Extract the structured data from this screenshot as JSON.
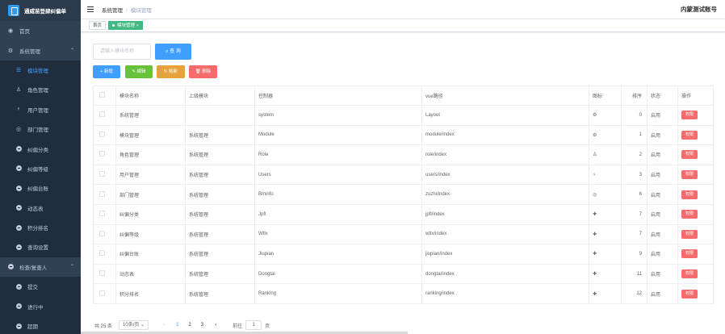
{
  "app": {
    "title": "通威苗登肆纠偏单"
  },
  "sidebar": {
    "items": [
      {
        "label": "首页",
        "icon": "dashboard-icon"
      },
      {
        "label": "系统管理",
        "icon": "gear-icon"
      },
      {
        "label": "模块管理",
        "icon": "menu-icon"
      },
      {
        "label": "角色管理",
        "icon": "user-icon"
      },
      {
        "label": "用户管理",
        "icon": "bulb-icon"
      },
      {
        "label": "部门管理",
        "icon": "target-icon"
      },
      {
        "label": "纠偏分类",
        "icon": "circle-plus-icon"
      },
      {
        "label": "纠偏等级",
        "icon": "circle-plus-icon"
      },
      {
        "label": "纠偏台账",
        "icon": "circle-plus-icon"
      },
      {
        "label": "动态表",
        "icon": "circle-plus-icon"
      },
      {
        "label": "积分排名",
        "icon": "circle-plus-icon"
      },
      {
        "label": "查询设置",
        "icon": "circle-plus-icon"
      },
      {
        "label": "检查/复查人",
        "icon": "circle-plus-icon"
      },
      {
        "label": "提交",
        "icon": "circle-plus-icon"
      },
      {
        "label": "进行中",
        "icon": "circle-plus-icon"
      },
      {
        "label": "超期",
        "icon": "circle-plus-icon"
      }
    ]
  },
  "header": {
    "breadcrumb": [
      "系统管理",
      "模块管理"
    ],
    "user": "内蒙测试账号"
  },
  "tags": [
    "首页",
    "模块管理"
  ],
  "search": {
    "placeholder": "请输入模块名称",
    "button": "查 询"
  },
  "toolbar": {
    "add": "+ 新增",
    "edit": "✎ 编辑",
    "refresh": "↻ 刷新",
    "delete": "🗑 删除"
  },
  "table": {
    "headers": [
      "模块名称",
      "上级模块",
      "控制器",
      "vue路径",
      "图标",
      "排序",
      "状态",
      "操作"
    ],
    "rows": [
      {
        "name": "系统管理",
        "parent": "",
        "controller": "system",
        "path": "Layout",
        "icon": "⚙",
        "order": "0",
        "status": "启用",
        "action": "权限"
      },
      {
        "name": "模块管理",
        "parent": "系统管理",
        "controller": "Module",
        "path": "module/index",
        "icon": "⚙",
        "order": "1",
        "status": "启用",
        "action": "权限"
      },
      {
        "name": "角色管理",
        "parent": "系统管理",
        "controller": "Role",
        "path": "role/index",
        "icon": "♙",
        "order": "2",
        "status": "启用",
        "action": "权限"
      },
      {
        "name": "用户管理",
        "parent": "系统管理",
        "controller": "Users",
        "path": "users/index",
        "icon": "♀",
        "order": "3",
        "status": "启用",
        "action": "权限"
      },
      {
        "name": "部门管理",
        "parent": "系统管理",
        "controller": "Bminfo",
        "path": "zuzhi/index",
        "icon": "◎",
        "order": "6",
        "status": "启用",
        "action": "权限"
      },
      {
        "name": "纠偏分类",
        "parent": "系统管理",
        "controller": "Jpfl",
        "path": "jpfl/index",
        "icon": "✚",
        "order": "7",
        "status": "启用",
        "action": "权限"
      },
      {
        "name": "纠偏等级",
        "parent": "系统管理",
        "controller": "Wtlx",
        "path": "wtlx/index",
        "icon": "✚",
        "order": "7",
        "status": "启用",
        "action": "权限"
      },
      {
        "name": "纠偏台账",
        "parent": "系统管理",
        "controller": "Jiupian",
        "path": "jiupian/index",
        "icon": "✚",
        "order": "9",
        "status": "启用",
        "action": "权限"
      },
      {
        "name": "动态表",
        "parent": "系统管理",
        "controller": "Dongtai",
        "path": "dongtai/index",
        "icon": "✚",
        "order": "11",
        "status": "启用",
        "action": "权限"
      },
      {
        "name": "积分排名",
        "parent": "系统管理",
        "controller": "Ranking",
        "path": "ranking/index",
        "icon": "✚",
        "order": "12",
        "status": "启用",
        "action": "权限"
      }
    ]
  },
  "pagination": {
    "total": "共 25 条",
    "size": "10条/页",
    "pages": [
      "1",
      "2",
      "3"
    ],
    "goto_label": "前往",
    "goto_value": "1",
    "goto_suffix": "页"
  }
}
